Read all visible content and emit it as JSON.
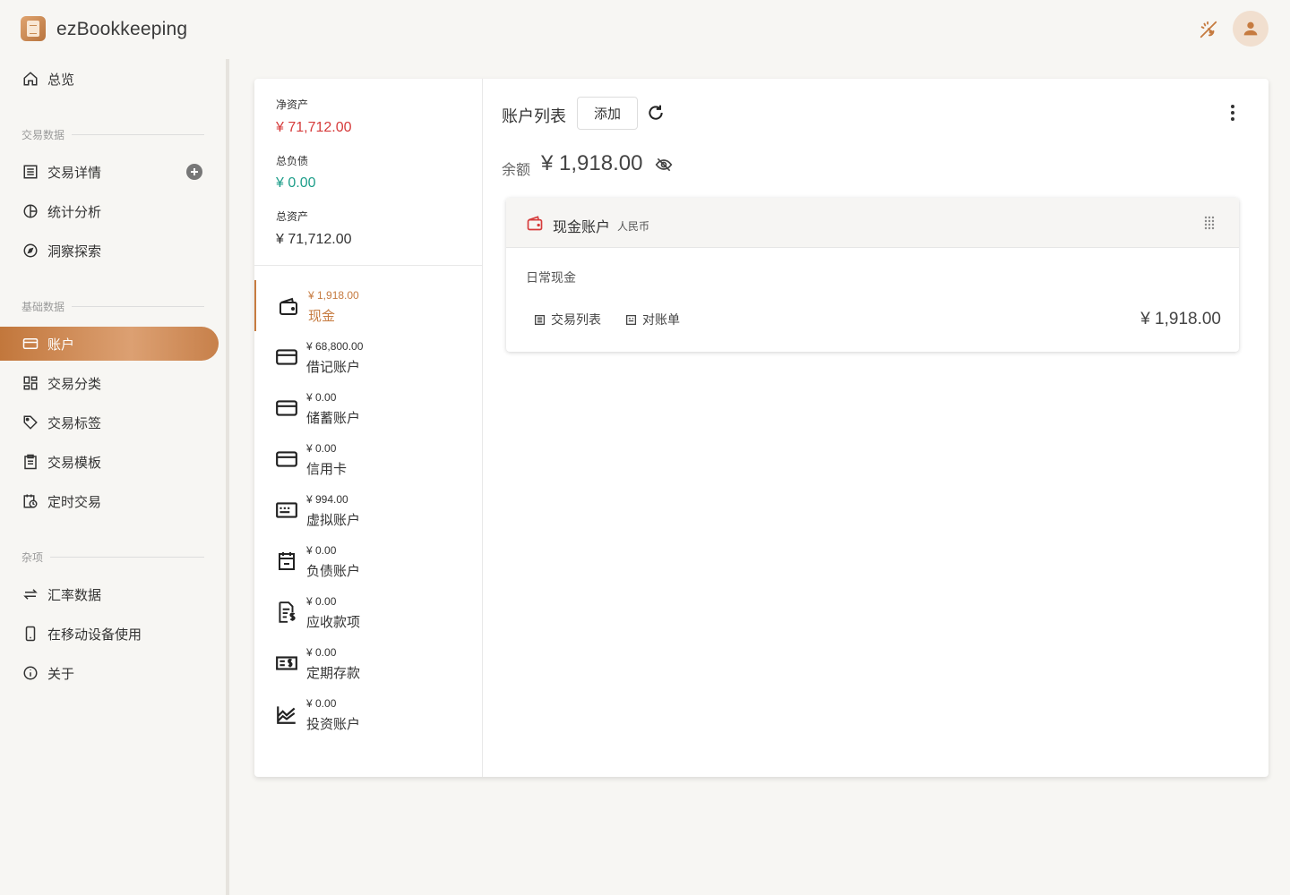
{
  "app": {
    "title": "ezBookkeeping"
  },
  "sidebar": {
    "overview": "总览",
    "section_transactions": "交易数据",
    "transaction_details": "交易详情",
    "statistics": "统计分析",
    "insights": "洞察探索",
    "section_basic": "基础数据",
    "accounts": "账户",
    "categories": "交易分类",
    "tags": "交易标签",
    "templates": "交易模板",
    "scheduled": "定时交易",
    "section_misc": "杂项",
    "exchange_rates": "汇率数据",
    "mobile": "在移动设备使用",
    "about": "关于"
  },
  "summary": {
    "net_assets_label": "净资产",
    "net_assets_value": "¥ 71,712.00",
    "total_liabilities_label": "总负债",
    "total_liabilities_value": "¥ 0.00",
    "total_assets_label": "总资产",
    "total_assets_value": "¥ 71,712.00"
  },
  "categories": [
    {
      "value": "¥ 1,918.00",
      "name": "现金",
      "icon": "wallet-icon"
    },
    {
      "value": "¥ 68,800.00",
      "name": "借记账户",
      "icon": "credit-card-icon"
    },
    {
      "value": "¥ 0.00",
      "name": "储蓄账户",
      "icon": "credit-card-icon"
    },
    {
      "value": "¥ 0.00",
      "name": "信用卡",
      "icon": "credit-card-icon"
    },
    {
      "value": "¥ 994.00",
      "name": "虚拟账户",
      "icon": "virtual-card-icon"
    },
    {
      "value": "¥ 0.00",
      "name": "负债账户",
      "icon": "calendar-minus-icon"
    },
    {
      "value": "¥ 0.00",
      "name": "应收款项",
      "icon": "receivable-document-icon"
    },
    {
      "value": "¥ 0.00",
      "name": "定期存款",
      "icon": "deposit-money-icon"
    },
    {
      "value": "¥ 0.00",
      "name": "投资账户",
      "icon": "investment-chart-icon"
    }
  ],
  "account_list": {
    "title": "账户列表",
    "add_label": "添加",
    "balance_label": "余额",
    "balance_value": "¥ 1,918.00"
  },
  "account": {
    "name": "现金账户",
    "currency": "人民币",
    "description": "日常现金",
    "transactions_link": "交易列表",
    "reconciliation_link": "对账单",
    "amount": "¥ 1,918.00"
  },
  "colors": {
    "accent": "#c67b40",
    "negative": "#d63b3b",
    "positive": "#1e9e8a"
  }
}
